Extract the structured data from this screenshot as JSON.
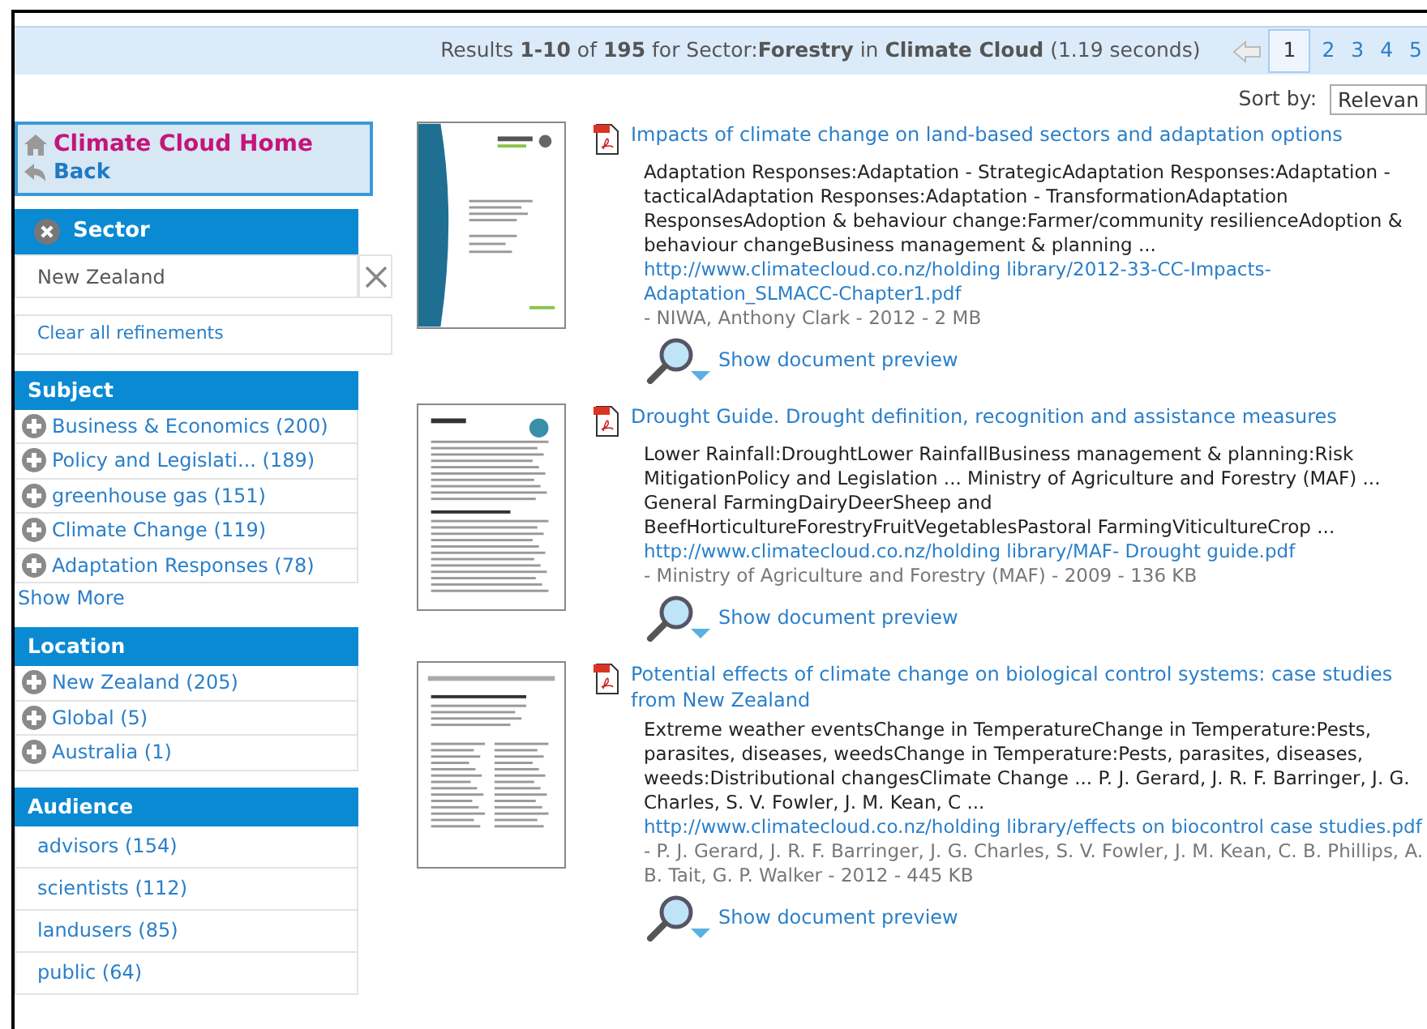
{
  "results_bar": {
    "summary": "Results **1-10** of **195** for Sector:**Forestry** in **Climate Cloud** (1.19 seconds)",
    "pages": [
      {
        "label": "1",
        "selected": true
      },
      {
        "label": "2",
        "selected": false
      },
      {
        "label": "3",
        "selected": false
      },
      {
        "label": "4",
        "selected": false
      },
      {
        "label": "5",
        "selected": false
      }
    ],
    "sort_label": "Sort by:",
    "sort_value": "Relevan"
  },
  "sidebar": {
    "home": "Climate Cloud Home",
    "back": "Back",
    "active_refinement": {
      "title": "Sector",
      "value": "New Zealand"
    },
    "clear_all": "Clear all refinements",
    "facets": [
      {
        "title": "Subject",
        "kind": "expandable",
        "items": [
          "Business & Economics (200)",
          "Policy and Legislati... (189)",
          "greenhouse gas (151)",
          "Climate Change (119)",
          "Adaptation Responses (78)"
        ],
        "show_more": "Show More"
      },
      {
        "title": "Location",
        "kind": "expandable",
        "items": [
          "New Zealand (205)",
          "Global (5)",
          "Australia (1)"
        ]
      },
      {
        "title": "Audience",
        "kind": "plain",
        "items": [
          "advisors (154)",
          "scientists (112)",
          "landusers (85)",
          "public (64)"
        ]
      }
    ]
  },
  "results": [
    {
      "title": "Impacts of climate change on land-based sectors and adaptation options",
      "snippet": "Adaptation Responses:Adaptation - StrategicAdaptation Responses:Adaptation - tacticalAdaptation Responses:Adaptation - TransformationAdaptation ResponsesAdoption & behaviour change:Farmer/community resilienceAdoption & behaviour changeBusiness management & planning ...",
      "url": "http://www.climatecloud.co.nz/holding library/2012-33-CC-Impacts-Adaptation_SLMACC-Chapter1.pdf",
      "details": "- NIWA, Anthony Clark - 2012 - 2 MB",
      "preview": "Show document preview"
    },
    {
      "title": "Drought Guide. Drought definition, recognition and assistance measures",
      "snippet": "Lower Rainfall:DroughtLower RainfallBusiness management & planning:Risk MitigationPolicy and Legislation ... Ministry of Agriculture and Forestry (MAF) ... General FarmingDairyDeerSheep and BeefHorticultureForestryFruitVegetablesPastoral FarmingViticultureCrop ...",
      "url": "http://www.climatecloud.co.nz/holding library/MAF- Drought guide.pdf",
      "details": "- Ministry of Agriculture and Forestry (MAF) - 2009 - 136 KB",
      "preview": "Show document preview"
    },
    {
      "title": "Potential effects of climate change on biological control systems: case studies from New Zealand",
      "snippet": "Extreme weather eventsChange in TemperatureChange in Temperature:Pests, parasites, diseases, weedsChange in Temperature:Pests, parasites, diseases, weeds:Distributional changesClimate Change ... P. J. Gerard, J. R. F. Barringer, J. G. Charles, S. V. Fowler, J. M. Kean, C ...",
      "url": "http://www.climatecloud.co.nz/holding library/effects on biocontrol case studies.pdf",
      "details": "- P. J. Gerard, J. R. F. Barringer, J. G. Charles, S. V. Fowler, J. M. Kean, C. B. Phillips, A. B. Tait, G. P. Walker - 2012 - 445 KB",
      "preview": "Show document preview"
    }
  ]
}
